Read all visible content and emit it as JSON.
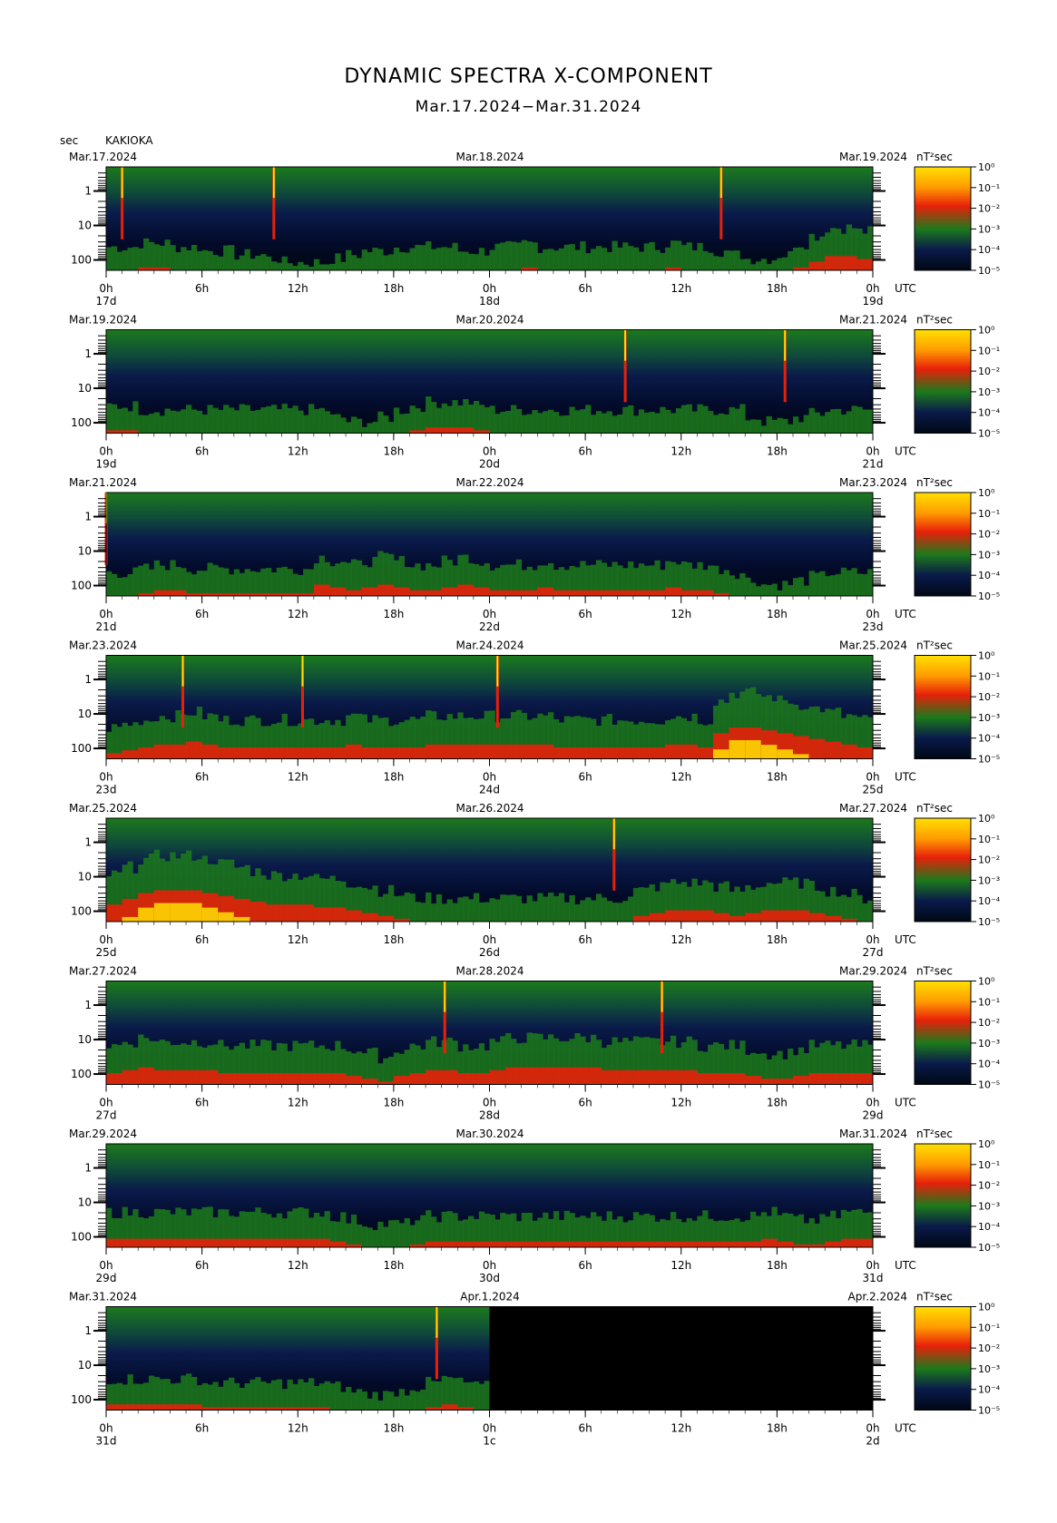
{
  "title": "DYNAMIC SPECTRA X-COMPONENT",
  "subtitle": "Mar.17.2024−Mar.31.2024",
  "y_unit_label": "sec",
  "station": "KAKIOKA",
  "colorbar_unit": "nT²sec",
  "colorbar_ticks": [
    "10⁰",
    "10⁻¹",
    "10⁻²",
    "10⁻³",
    "10⁻⁴",
    "10⁻⁵"
  ],
  "colors": {
    "background": "#ffffff",
    "spectrum_low": "#000814",
    "spectrum_mid_blue": "#0a1a4a",
    "spectrum_green": "#1c7a1c",
    "spectrum_red": "#e8200a",
    "spectrum_yellow": "#ffe000"
  },
  "chart_data": {
    "type": "heatmap",
    "x_axis": {
      "tick_labels": [
        "0h",
        "6h",
        "12h",
        "18h",
        "0h",
        "6h",
        "12h",
        "18h",
        "0h"
      ],
      "tz_label": "UTC"
    },
    "y_axis": {
      "scale": "log",
      "tick_labels": [
        "1",
        "10",
        "100"
      ],
      "label": "sec",
      "inverted": true
    },
    "panels": [
      {
        "start_date": "Mar.17.2024",
        "mid_date": "Mar.18.2024",
        "end_date": "Mar.19.2024",
        "day_labels": [
          "17d",
          "18d",
          "19d"
        ],
        "spikes_hours": [
          1,
          10.5,
          38.5
        ],
        "activity": [
          0.3,
          0.3,
          0.35,
          0.35,
          0.3,
          0.3,
          0.25,
          0.25,
          0.2,
          0.2,
          0.15,
          0.1,
          0.1,
          0.1,
          0.15,
          0.2,
          0.25,
          0.25,
          0.3,
          0.3,
          0.3,
          0.3,
          0.25,
          0.25,
          0.3,
          0.3,
          0.35,
          0.3,
          0.3,
          0.3,
          0.3,
          0.3,
          0.3,
          0.3,
          0.3,
          0.35,
          0.3,
          0.3,
          0.25,
          0.2,
          0.15,
          0.15,
          0.2,
          0.35,
          0.45,
          0.55,
          0.55,
          0.5
        ],
        "data_end_hour": 48
      },
      {
        "start_date": "Mar.19.2024",
        "mid_date": "Mar.20.2024",
        "end_date": "Mar.21.2024",
        "day_labels": [
          "19d",
          "20d",
          "21d"
        ],
        "spikes_hours": [
          32.5,
          42.5
        ],
        "activity": [
          0.35,
          0.35,
          0.3,
          0.3,
          0.3,
          0.3,
          0.3,
          0.3,
          0.3,
          0.3,
          0.3,
          0.3,
          0.3,
          0.3,
          0.2,
          0.15,
          0.15,
          0.2,
          0.3,
          0.35,
          0.4,
          0.4,
          0.4,
          0.35,
          0.3,
          0.3,
          0.3,
          0.3,
          0.3,
          0.3,
          0.3,
          0.3,
          0.3,
          0.3,
          0.3,
          0.3,
          0.3,
          0.3,
          0.3,
          0.3,
          0.2,
          0.15,
          0.15,
          0.2,
          0.25,
          0.3,
          0.3,
          0.3
        ],
        "data_end_hour": 48
      },
      {
        "start_date": "Mar.21.2024",
        "mid_date": "Mar.22.2024",
        "end_date": "Mar.23.2024",
        "day_labels": [
          "21d",
          "22d",
          "23d"
        ],
        "spikes_hours": [
          0
        ],
        "activity": [
          0.3,
          0.3,
          0.35,
          0.4,
          0.4,
          0.35,
          0.35,
          0.35,
          0.35,
          0.35,
          0.35,
          0.35,
          0.35,
          0.5,
          0.45,
          0.4,
          0.45,
          0.5,
          0.45,
          0.4,
          0.4,
          0.45,
          0.5,
          0.45,
          0.4,
          0.4,
          0.4,
          0.45,
          0.4,
          0.4,
          0.4,
          0.4,
          0.4,
          0.4,
          0.4,
          0.45,
          0.4,
          0.4,
          0.35,
          0.3,
          0.2,
          0.15,
          0.15,
          0.2,
          0.25,
          0.3,
          0.3,
          0.3
        ],
        "data_end_hour": 48
      },
      {
        "start_date": "Mar.23.2024",
        "mid_date": "Mar.24.2024",
        "end_date": "Mar.25.2024",
        "day_labels": [
          "23d",
          "24d",
          "25d"
        ],
        "spikes_hours": [
          4.8,
          12.3,
          24.5
        ],
        "activity": [
          0.4,
          0.45,
          0.5,
          0.55,
          0.55,
          0.6,
          0.55,
          0.5,
          0.5,
          0.5,
          0.5,
          0.5,
          0.5,
          0.5,
          0.5,
          0.55,
          0.5,
          0.5,
          0.5,
          0.5,
          0.55,
          0.55,
          0.55,
          0.55,
          0.55,
          0.55,
          0.55,
          0.55,
          0.5,
          0.5,
          0.5,
          0.5,
          0.5,
          0.5,
          0.5,
          0.55,
          0.55,
          0.5,
          0.75,
          0.85,
          0.85,
          0.8,
          0.75,
          0.7,
          0.65,
          0.6,
          0.55,
          0.5
        ],
        "data_end_hour": 48
      },
      {
        "start_date": "Mar.25.2024",
        "mid_date": "Mar.26.2024",
        "end_date": "Mar.27.2024",
        "day_labels": [
          "25d",
          "26d",
          "27d"
        ],
        "spikes_hours": [
          31.8
        ],
        "activity": [
          0.6,
          0.7,
          0.8,
          0.85,
          0.85,
          0.85,
          0.8,
          0.75,
          0.7,
          0.65,
          0.6,
          0.6,
          0.6,
          0.55,
          0.55,
          0.5,
          0.45,
          0.4,
          0.35,
          0.3,
          0.3,
          0.3,
          0.3,
          0.3,
          0.3,
          0.3,
          0.3,
          0.3,
          0.3,
          0.3,
          0.3,
          0.3,
          0.3,
          0.4,
          0.45,
          0.5,
          0.5,
          0.5,
          0.45,
          0.4,
          0.45,
          0.5,
          0.5,
          0.5,
          0.45,
          0.4,
          0.35,
          0.3
        ],
        "data_end_hour": 48
      },
      {
        "start_date": "Mar.27.2024",
        "mid_date": "Mar.28.2024",
        "end_date": "Mar.29.2024",
        "day_labels": [
          "27d",
          "28d",
          "29d"
        ],
        "spikes_hours": [
          21.2,
          34.8
        ],
        "activity": [
          0.5,
          0.55,
          0.6,
          0.55,
          0.55,
          0.55,
          0.55,
          0.5,
          0.5,
          0.5,
          0.5,
          0.5,
          0.5,
          0.5,
          0.5,
          0.45,
          0.4,
          0.35,
          0.45,
          0.5,
          0.55,
          0.55,
          0.5,
          0.5,
          0.55,
          0.6,
          0.6,
          0.6,
          0.6,
          0.6,
          0.6,
          0.55,
          0.55,
          0.55,
          0.55,
          0.55,
          0.55,
          0.5,
          0.5,
          0.5,
          0.45,
          0.4,
          0.4,
          0.45,
          0.5,
          0.5,
          0.5,
          0.5
        ],
        "data_end_hour": 48
      },
      {
        "start_date": "Mar.29.2024",
        "mid_date": "Mar.30.2024",
        "end_date": "Mar.31.2024",
        "day_labels": [
          "29d",
          "30d",
          "31d"
        ],
        "spikes_hours": [],
        "activity": [
          0.45,
          0.45,
          0.45,
          0.45,
          0.45,
          0.45,
          0.45,
          0.45,
          0.45,
          0.45,
          0.45,
          0.45,
          0.45,
          0.45,
          0.4,
          0.35,
          0.3,
          0.3,
          0.3,
          0.35,
          0.4,
          0.4,
          0.4,
          0.4,
          0.4,
          0.4,
          0.4,
          0.4,
          0.4,
          0.4,
          0.4,
          0.4,
          0.4,
          0.4,
          0.4,
          0.4,
          0.4,
          0.4,
          0.4,
          0.4,
          0.4,
          0.45,
          0.4,
          0.35,
          0.35,
          0.4,
          0.45,
          0.45
        ],
        "data_end_hour": 48
      },
      {
        "start_date": "Mar.31.2024",
        "mid_date": "Apr.1.2024",
        "end_date": "Apr.2.2024",
        "day_labels": [
          "31d",
          "1c",
          "2d"
        ],
        "spikes_hours": [
          20.7
        ],
        "activity": [
          0.4,
          0.4,
          0.4,
          0.4,
          0.4,
          0.4,
          0.35,
          0.35,
          0.35,
          0.35,
          0.35,
          0.35,
          0.35,
          0.35,
          0.3,
          0.25,
          0.2,
          0.2,
          0.25,
          0.3,
          0.35,
          0.4,
          0.35,
          0.3
        ],
        "data_end_hour": 24
      }
    ]
  }
}
